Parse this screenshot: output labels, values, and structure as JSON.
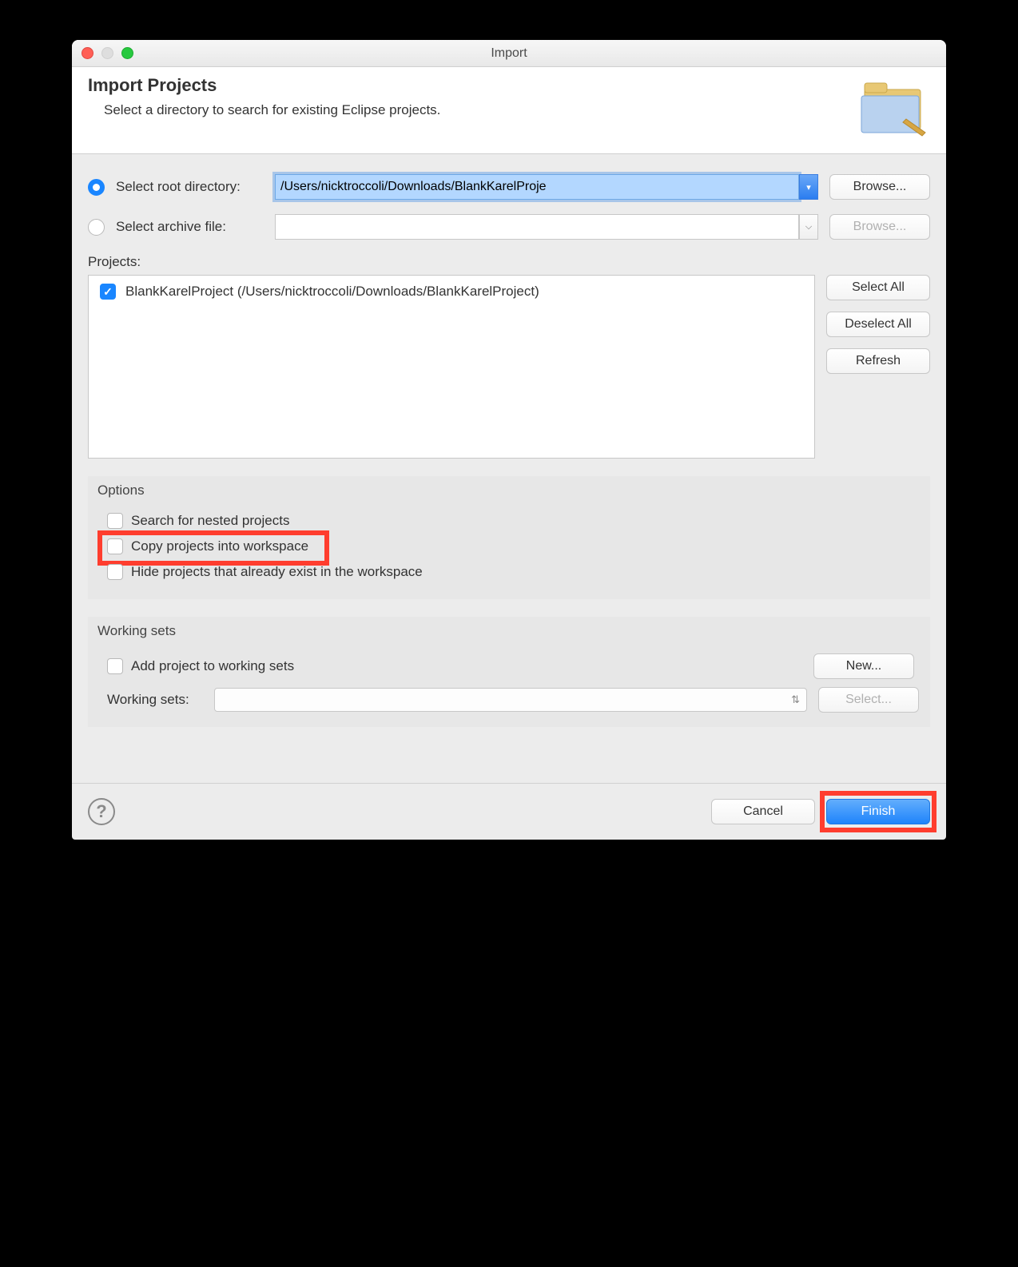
{
  "window": {
    "title": "Import"
  },
  "header": {
    "heading": "Import Projects",
    "subtitle": "Select a directory to search for existing Eclipse projects."
  },
  "source": {
    "root_radio_label": "Select root directory:",
    "root_value": "/Users/nicktroccoli/Downloads/BlankKarelProje",
    "root_browse": "Browse...",
    "archive_radio_label": "Select archive file:",
    "archive_value": "",
    "archive_browse": "Browse..."
  },
  "projects": {
    "label": "Projects:",
    "items": [
      {
        "checked": true,
        "text": "BlankKarelProject (/Users/nicktroccoli/Downloads/BlankKarelProject)"
      }
    ],
    "buttons": {
      "select_all": "Select All",
      "deselect_all": "Deselect All",
      "refresh": "Refresh"
    }
  },
  "options": {
    "group_title": "Options",
    "search_nested": "Search for nested projects",
    "copy_workspace": "Copy projects into workspace",
    "hide_existing": "Hide projects that already exist in the workspace"
  },
  "working_sets": {
    "group_title": "Working sets",
    "add_label": "Add project to working sets",
    "new_btn": "New...",
    "ws_label": "Working sets:",
    "select_btn": "Select..."
  },
  "footer": {
    "cancel": "Cancel",
    "finish": "Finish"
  }
}
